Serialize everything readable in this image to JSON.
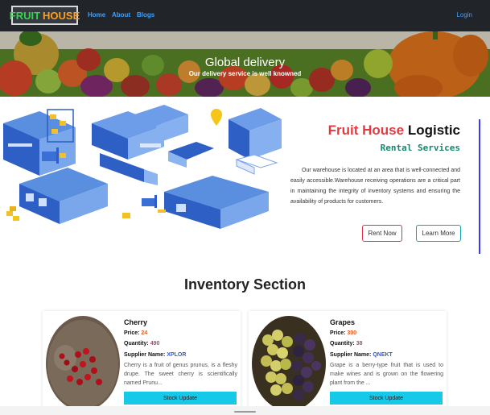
{
  "navbar": {
    "brand_part1": "FRUIT",
    "brand_part2": "HOUSE",
    "links": [
      "Home",
      "About",
      "Blogs"
    ],
    "login": "Login"
  },
  "banner": {
    "title": "Global delivery",
    "subtitle": "Our delivery service is well knowned"
  },
  "logistic": {
    "title_red": "Fruit House",
    "title_dark": "Logistic",
    "subtitle": "Rental Services",
    "description": "Our warehouse is located at an area that is well-connected and easily accessible.Warehouse receiving operations are a critical part in maintaining the integrity of inventory systems and ensuring the availability of products for customers.",
    "rent_button": "Rent Now",
    "learn_button": "Learn More"
  },
  "inventory": {
    "title": "Inventory Section",
    "price_label": "Price:",
    "quantity_label": "Quantity:",
    "supplier_label": "Supplier Name:",
    "items": [
      {
        "name": "Cherry",
        "price": "24",
        "quantity": "490",
        "supplier": "XPLOR",
        "description": "Cherry is a fruit of genus prunus, is a fleshy drupe. The sweet cherry is scientifically named Prunu...",
        "button": "Stock Update"
      },
      {
        "name": "Grapes",
        "price": "300",
        "quantity": "38",
        "supplier": "QNEKT",
        "description": "Grape is a berry-type fruit that is used to make wines and is grown on the flowering plant from the ...",
        "button": "Stock Update"
      }
    ]
  },
  "colors": {
    "navbar_bg": "#212529",
    "brand_green": "#32d74b",
    "brand_orange": "#ff9f1c",
    "link_blue": "#3ba0ff",
    "accent_red": "#e8383d",
    "subtitle_teal": "#17876b",
    "stock_button": "#17c9e8"
  }
}
